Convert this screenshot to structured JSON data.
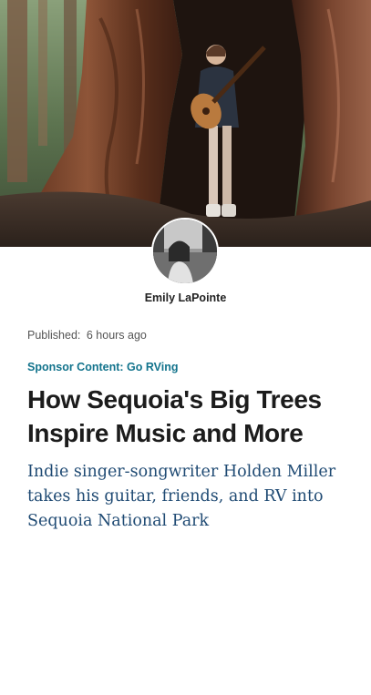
{
  "hero": {
    "image_alt": "Musician playing guitar inside a giant sequoia tree"
  },
  "author": {
    "name": "Emily LaPointe"
  },
  "meta": {
    "published_label": "Published:",
    "published_time": "6 hours ago"
  },
  "sponsor": {
    "label": "Sponsor Content: Go RVing"
  },
  "article": {
    "headline": "How Sequoia's Big Trees Inspire Music and More",
    "dek": "Indie singer-songwriter Holden Miller takes his guitar, friends, and RV into Sequoia National Park"
  },
  "colors": {
    "sponsor": "#12738c",
    "dek": "#1f4a73",
    "headline": "#1c1c1c"
  }
}
